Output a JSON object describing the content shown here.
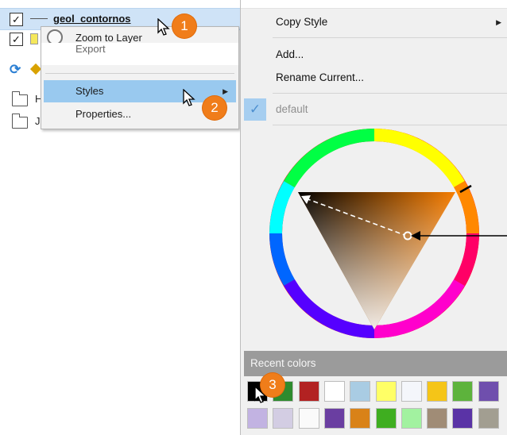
{
  "layers": {
    "selected_layer_name": "geol_contornos",
    "tree_letters": [
      "H",
      "J"
    ]
  },
  "context_menu": {
    "items": [
      {
        "label": "Zoom to Layer",
        "has_submenu": false
      },
      {
        "label": "Export",
        "has_submenu": false
      },
      {
        "label": "Styles",
        "has_submenu": true
      },
      {
        "label": "Properties...",
        "has_submenu": false
      }
    ]
  },
  "styles_menu": {
    "copy_style": "Copy Style",
    "add": "Add...",
    "rename_current": "Rename Current...",
    "current_style": "default"
  },
  "color_picker": {
    "selected_color": "#F57C00",
    "recent_colors_label": "Recent colors",
    "recent_colors": [
      "#000000",
      "#2e8b2e",
      "#b22222",
      "#ffffff",
      "#a9cce3",
      "#ffff66",
      "#f4f6fb",
      "#f5c518",
      "#5db33c",
      "#6f4fad",
      "#c2b3e2",
      "#d3cde3",
      "#fafafa",
      "#6a3ea1",
      "#d98218",
      "#3fae20",
      "#a2f2a0",
      "#a08c76",
      "#5a33a6",
      "#a29e91"
    ]
  },
  "callouts": [
    "1",
    "2",
    "3"
  ]
}
